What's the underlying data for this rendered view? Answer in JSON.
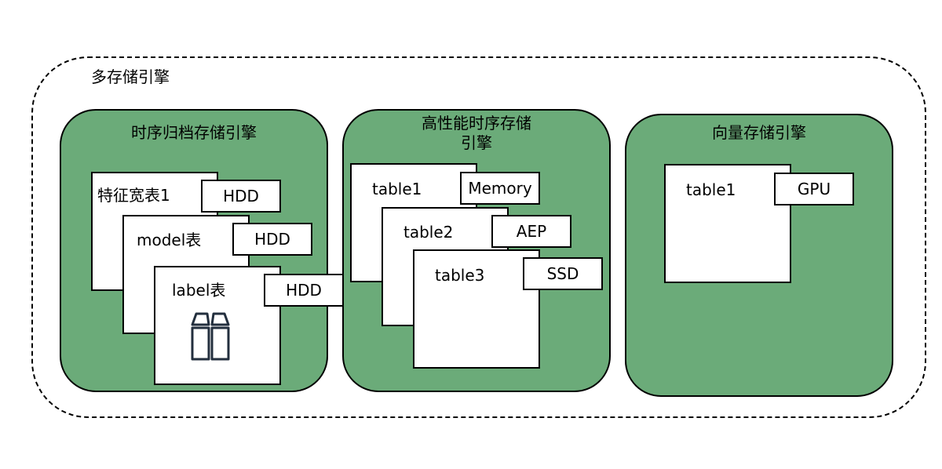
{
  "outer": {
    "label": "多存储引擎"
  },
  "engines": [
    {
      "title": "时序归档存储引擎",
      "tables": [
        {
          "label": "特征宽表1",
          "storage": "HDD"
        },
        {
          "label": "model表",
          "storage": "HDD"
        },
        {
          "label": "label表",
          "storage": "HDD",
          "icon": "cylinder-icon"
        }
      ]
    },
    {
      "title_line1": "高性能时序存储",
      "title_line2": "引擎",
      "tables": [
        {
          "label": "table1",
          "storage": "Memory"
        },
        {
          "label": "table2",
          "storage": "AEP"
        },
        {
          "label": "table3",
          "storage": "SSD"
        }
      ]
    },
    {
      "title": "向量存储引擎",
      "tables": [
        {
          "label": "table1",
          "storage": "GPU"
        }
      ]
    }
  ],
  "colors": {
    "engine_fill": "#6bab79",
    "card_fill": "#ffffff",
    "stroke": "#000000"
  }
}
